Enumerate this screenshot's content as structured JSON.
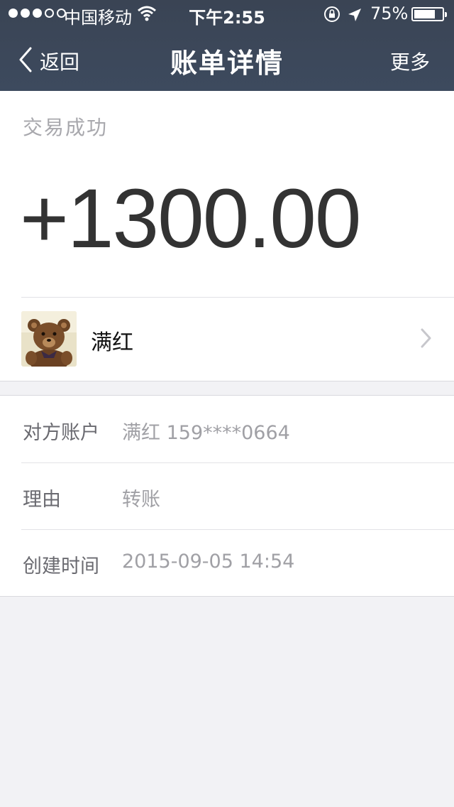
{
  "status_bar": {
    "carrier": "中国移动",
    "time": "下午2:55",
    "battery_percent": "75%",
    "battery_level": 0.75,
    "signal_strength": 3,
    "signal_max": 5
  },
  "nav": {
    "back_label": "返回",
    "title": "账单详情",
    "more_label": "更多"
  },
  "transaction": {
    "status": "交易成功",
    "amount": "+1300.00"
  },
  "payer": {
    "name": "满红",
    "avatar_description": "teddy-bear-avatar"
  },
  "details": [
    {
      "label": "对方账户",
      "value": "满红 159****0664"
    },
    {
      "label": "理由",
      "value": "转账"
    },
    {
      "label": "创建时间",
      "value": "2015-09-05 14:54"
    }
  ],
  "colors": {
    "nav_background": "#3d4a5e",
    "page_background": "#f2f2f5",
    "amount_text": "#333333",
    "muted_text": "#a0a0a5"
  }
}
